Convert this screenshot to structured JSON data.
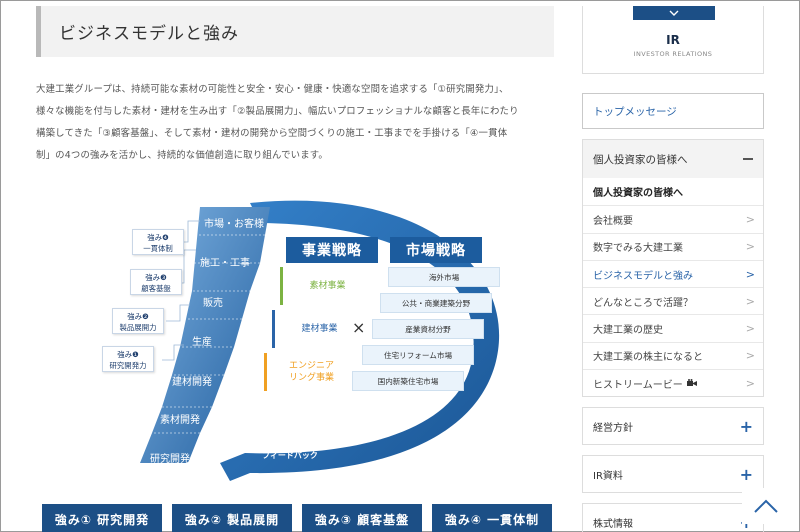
{
  "section_title": "ビジネスモデルと強み",
  "intro_lines": [
    "大建工業グループは、持続可能な素材の可能性と安全・安心・健康・快適な空間を追求する「①研究開発力」、",
    "様々な機能を付与した素材・建材を生み出す「②製品展開力」、幅広いプロフェッショナルな顧客と長年にわたり",
    "構築してきた「③顧客基盤」、そして素材・建材の開発から空間づくりの施工・工事までを手掛ける「④一貫体",
    "制」の4つの強みを活かし、持続的な価値創造に取り組んでいます。"
  ],
  "diagram": {
    "stairs": [
      "市場・お客様",
      "施工・工事",
      "販売",
      "生産",
      "建材開発",
      "素材開発",
      "研究開発"
    ],
    "strengths": [
      {
        "line1": "強み❹",
        "line2": "一貫体制"
      },
      {
        "line1": "強み❸",
        "line2": "顧客基盤"
      },
      {
        "line1": "強み❷",
        "line2": "製品展開力"
      },
      {
        "line1": "強み❶",
        "line2": "研究開発力"
      }
    ],
    "business_head": "事業戦略",
    "market_head": "市場戦略",
    "businesses": [
      {
        "name": "素材事業",
        "color": "#7cb342"
      },
      {
        "name": "建材事業",
        "color": "#2a64a8"
      },
      {
        "name": "エンジニア\nリング事業",
        "color": "#f0a022"
      }
    ],
    "cross": "×",
    "markets": [
      "海外市場",
      "公共・商業建築分野",
      "産業資材分野",
      "住宅リフォーム市場",
      "国内新築住宅市場"
    ],
    "feedback": "新たな価値創造への\nフィードバック"
  },
  "bottom_buttons": [
    "強み① 研究開発",
    "強み② 製品展開",
    "強み③ 顧客基盤",
    "強み④ 一貫体制"
  ],
  "sidebar": {
    "ir_title": "IR",
    "ir_subtitle": "INVESTOR RELATIONS",
    "top_message": "トップメッセージ",
    "accordion_head": "個人投資家の皆様へ",
    "items": [
      {
        "label": "個人投資家の皆様へ",
        "style": "bold"
      },
      {
        "label": "会社概要",
        "style": ""
      },
      {
        "label": "数字でみる大建工業",
        "style": ""
      },
      {
        "label": "ビジネスモデルと強み",
        "style": "active"
      },
      {
        "label": "どんなところで活躍？",
        "style": ""
      },
      {
        "label": "大建工業の歴史",
        "style": ""
      },
      {
        "label": "大建工業の株主になると",
        "style": ""
      },
      {
        "label": "ヒストリームービー",
        "style": "video"
      }
    ],
    "sections": [
      "経営方針",
      "IR資料",
      "株式情報"
    ]
  },
  "colors": {
    "primary": "#1c4f86",
    "accent": "#2a64a8",
    "stair": "#3f7fbf"
  }
}
